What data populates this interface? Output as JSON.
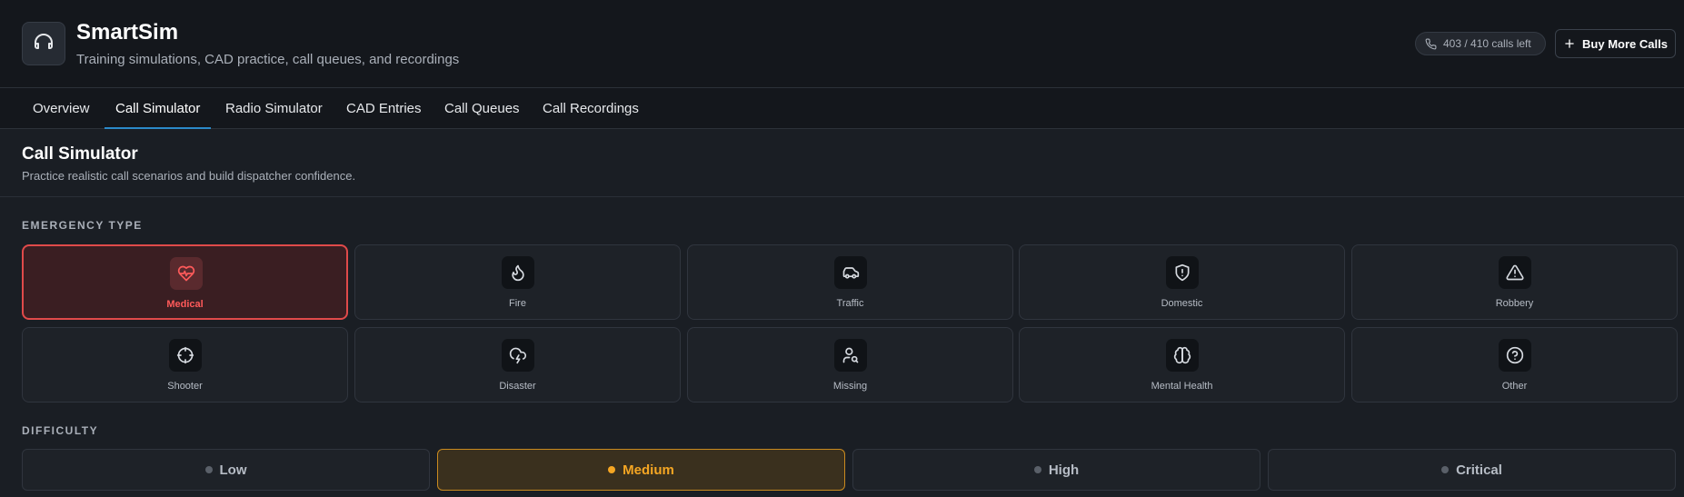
{
  "app": {
    "title": "SmartSim",
    "subtitle": "Training simulations, CAD practice, call queues, and recordings",
    "logo_icon": "headphones-icon"
  },
  "header": {
    "calls_left": "403 / 410 calls left",
    "calls_icon": "phone-icon",
    "buy_label": "Buy More Calls",
    "buy_icon": "plus-icon"
  },
  "tabs": [
    {
      "label": "Overview",
      "active": false
    },
    {
      "label": "Call Simulator",
      "active": true
    },
    {
      "label": "Radio Simulator",
      "active": false
    },
    {
      "label": "CAD Entries",
      "active": false
    },
    {
      "label": "Call Queues",
      "active": false
    },
    {
      "label": "Call Recordings",
      "active": false
    }
  ],
  "section": {
    "title": "Call Simulator",
    "description": "Practice realistic call scenarios and build dispatcher confidence."
  },
  "emergency": {
    "label": "EMERGENCY TYPE",
    "selected": "Medical",
    "types": [
      {
        "label": "Medical",
        "icon": "heart-pulse-icon"
      },
      {
        "label": "Fire",
        "icon": "flame-icon"
      },
      {
        "label": "Traffic",
        "icon": "car-icon"
      },
      {
        "label": "Domestic",
        "icon": "shield-alert-icon"
      },
      {
        "label": "Robbery",
        "icon": "warning-triangle-icon"
      },
      {
        "label": "Shooter",
        "icon": "crosshair-icon"
      },
      {
        "label": "Disaster",
        "icon": "cloud-lightning-icon"
      },
      {
        "label": "Missing",
        "icon": "user-search-icon"
      },
      {
        "label": "Mental Health",
        "icon": "brain-icon"
      },
      {
        "label": "Other",
        "icon": "help-circle-icon"
      }
    ]
  },
  "difficulty": {
    "label": "DIFFICULTY",
    "selected": "Medium",
    "levels": [
      {
        "label": "Low"
      },
      {
        "label": "Medium"
      },
      {
        "label": "High"
      },
      {
        "label": "Critical"
      }
    ]
  },
  "colors": {
    "accent_tab": "#2b89c9",
    "selected_red": "#e04a4a",
    "selected_amber": "#f5a623"
  }
}
